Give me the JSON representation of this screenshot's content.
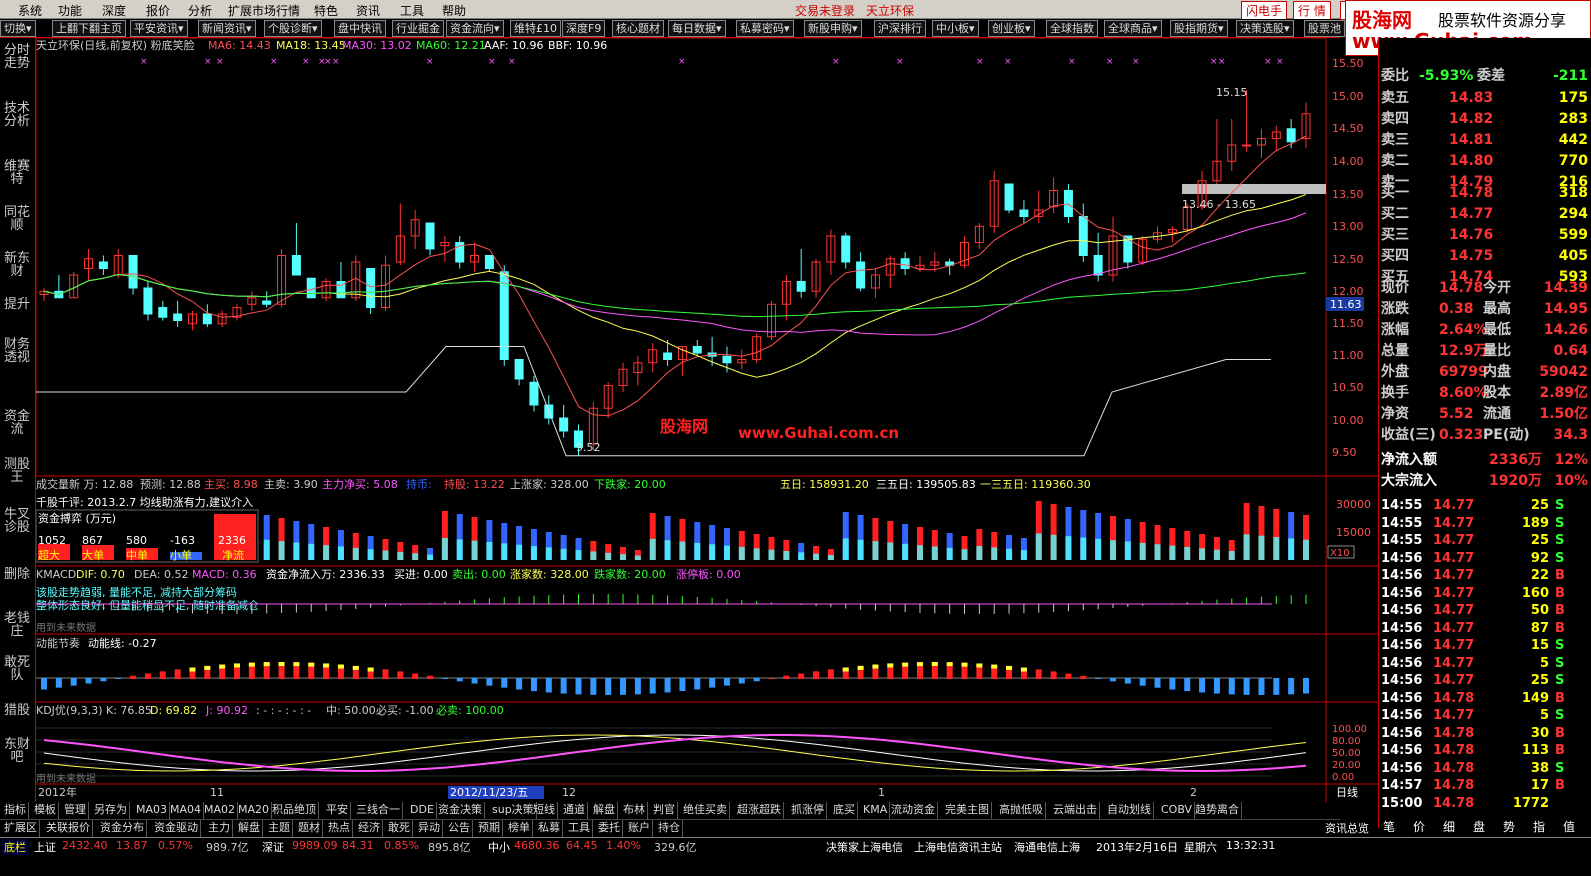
{
  "menu": [
    "系统",
    "功能",
    "深度",
    "报价",
    "分析",
    "扩展市场行情",
    "特色",
    "资讯",
    "工具",
    "帮助"
  ],
  "menu_right": {
    "login": "交易未登录",
    "stock": "天立环保",
    "flash": "闪电手",
    "quote": "行 情",
    "ask": "资 讯"
  },
  "logo": {
    "line1": "股海网",
    "line2": "股票软件资源分享",
    "url": "www.Guhai.com"
  },
  "toolbar": [
    "切换▾",
    "上翻下翻主页",
    "平安资讯▾",
    "新闻资讯▾",
    "个股诊断▾",
    "盘中快讯",
    "行业掘金",
    "资金流向▾",
    "维特£10",
    "深度F9",
    "核心题材",
    "每日数据▾",
    "私募密码▾",
    "新股申购▾",
    "沪深排行",
    "中小板▾",
    "创业板▾",
    "全球指数",
    "全球商品▾",
    "股指期货▾",
    "决策选股▾",
    "股票池"
  ],
  "sidebar": [
    "分时走势",
    "技术分析",
    "维赛特",
    "同花顺",
    "新东财",
    "提升",
    "财务透视",
    "资金流",
    "测股王",
    "牛叉诊股",
    "删除",
    "老钱庄",
    "敢死队",
    "猎股",
    "东财吧"
  ],
  "main_title": {
    "name": "天立环保(日线,前复权) 粉底笑脸",
    "ma6": "MA6: 14.43",
    "ma18": "MA18: 13.45",
    "ma30": "MA30: 13.02",
    "ma60": "MA60: 12.21",
    "aaf": "AAF: 10.96",
    "bbf": "BBF: 10.96"
  },
  "watermark": {
    "cn": "股海网",
    "url": "www.Guhai.com.cn"
  },
  "price_axis": [
    "15.50",
    "15.00",
    "14.50",
    "14.00",
    "13.50",
    "13.00",
    "12.50",
    "12.00",
    "11.50",
    "11.00",
    "10.50",
    "10.00",
    "9.50"
  ],
  "price_tag": "11.63",
  "annotations": {
    "high": "15.15",
    "low": "9.52",
    "band": "13.46 - 13.65"
  },
  "vol_title": {
    "a": "成交量新 万: 12.88",
    "b": "预测: 12.88",
    "c": "主买: 8.98",
    "d": "主卖: 3.90",
    "e": "主力净买: 5.08",
    "f": "持币: ",
    "g": "持股: 13.22",
    "h": "上涨家: 328.00",
    "i": "下跌家: 20.00",
    "j": "五日: 158931.20",
    "k": "三五日: 139505.83",
    "l": "一三五日: 119360.30"
  },
  "vol_note": "千股千评: 2013.2.7  均线助涨有力,建议介入",
  "fund_box": {
    "title": "资金搏弈 (万元)",
    "values": [
      "1052",
      "867",
      "580",
      "-163",
      "2336"
    ],
    "labels": [
      "超大",
      "大单",
      "中单",
      "小单",
      "净流"
    ]
  },
  "vol_axis": [
    "30000",
    "15000"
  ],
  "vol_unit": "X10",
  "macd_title": {
    "a": "KMACD",
    "b": "DIF: 0.70",
    "c": "DEA: 0.52",
    "d": "MACD: 0.36",
    "e": "资金净流入万: 2336.33",
    "f": "买进: 0.00",
    "g": "卖出: 0.00",
    "h": "涨家数: 328.00",
    "i": "跌家数: 20.00",
    "j": "涨停板: 0.00"
  },
  "macd_notes": [
    "该股走势趋弱, 量能不足, 减持大部分筹码",
    "整体形态良好, 但量能稍显不足, 随时准备减仓",
    "用到未来数据"
  ],
  "dn_title": {
    "a": "动能节奏",
    "b": "动能线: -0.27"
  },
  "kdj_title": {
    "a": "KDJ优(9,3,3)",
    "b": "K: 76.85",
    "c": "D: 69.82",
    "d": "J: 90.92",
    "e": ": - : - : - : -",
    "f": "中: 50.00",
    "g": "必买: -1.00",
    "h": "必卖: 100.00"
  },
  "kdj_note": "用到未来数据",
  "kdj_axis": [
    "100.00",
    "80.00",
    "50.00",
    "20.00",
    "0.00"
  ],
  "date_axis": {
    "y": "2012年",
    "m11": "11",
    "cur": "2012/11/23/五",
    "m12": "12",
    "m1": "1",
    "m2": "2",
    "type": "日线"
  },
  "quote": {
    "weibi": {
      "l": "委比",
      "v": "-5.93%",
      "l2": "委差",
      "v2": "-211"
    },
    "sell": [
      {
        "l": "卖五",
        "p": "14.83",
        "v": "175"
      },
      {
        "l": "卖四",
        "p": "14.82",
        "v": "283"
      },
      {
        "l": "卖三",
        "p": "14.81",
        "v": "442"
      },
      {
        "l": "卖二",
        "p": "14.80",
        "v": "770"
      },
      {
        "l": "卖一",
        "p": "14.79",
        "v": "216"
      }
    ],
    "buy": [
      {
        "l": "买一",
        "p": "14.78",
        "v": "318"
      },
      {
        "l": "买二",
        "p": "14.77",
        "v": "294"
      },
      {
        "l": "买三",
        "p": "14.76",
        "v": "599"
      },
      {
        "l": "买四",
        "p": "14.75",
        "v": "405"
      },
      {
        "l": "买五",
        "p": "14.74",
        "v": "593"
      }
    ],
    "stats": [
      {
        "a": "现价",
        "b": "14.78",
        "c": "今开",
        "d": "14.39"
      },
      {
        "a": "涨跌",
        "b": "0.38",
        "c": "最高",
        "d": "14.95"
      },
      {
        "a": "涨幅",
        "b": "2.64%",
        "c": "最低",
        "d": "14.26"
      },
      {
        "a": "总量",
        "b": "12.9万",
        "c": "量比",
        "d": "0.64"
      },
      {
        "a": "外盘",
        "b": "69799",
        "c": "内盘",
        "d": "59042"
      },
      {
        "a": "换手",
        "b": "8.60%",
        "c": "股本",
        "d": "2.89亿"
      },
      {
        "a": "净资",
        "b": "5.52",
        "c": "流通",
        "d": "1.50亿"
      },
      {
        "a": "收益(三)",
        "b": "0.323",
        "c": "PE(动)",
        "d": "34.3"
      }
    ],
    "flow": [
      {
        "a": "净流入额",
        "b": "2336万",
        "c": "12%"
      },
      {
        "a": "大宗流入",
        "b": "1920万",
        "c": "10%"
      }
    ],
    "ticks": [
      {
        "t": "14:55",
        "p": "14.77",
        "v": "25",
        "s": "S"
      },
      {
        "t": "14:55",
        "p": "14.77",
        "v": "189",
        "s": "S"
      },
      {
        "t": "14:55",
        "p": "14.77",
        "v": "25",
        "s": "S"
      },
      {
        "t": "14:56",
        "p": "14.77",
        "v": "92",
        "s": "S"
      },
      {
        "t": "14:56",
        "p": "14.77",
        "v": "22",
        "s": "B"
      },
      {
        "t": "14:56",
        "p": "14.77",
        "v": "160",
        "s": "B"
      },
      {
        "t": "14:56",
        "p": "14.77",
        "v": "50",
        "s": "B"
      },
      {
        "t": "14:56",
        "p": "14.77",
        "v": "87",
        "s": "B"
      },
      {
        "t": "14:56",
        "p": "14.77",
        "v": "15",
        "s": "S"
      },
      {
        "t": "14:56",
        "p": "14.77",
        "v": "5",
        "s": "S"
      },
      {
        "t": "14:56",
        "p": "14.77",
        "v": "25",
        "s": "S"
      },
      {
        "t": "14:56",
        "p": "14.78",
        "v": "149",
        "s": "B"
      },
      {
        "t": "14:56",
        "p": "14.77",
        "v": "5",
        "s": "S"
      },
      {
        "t": "14:56",
        "p": "14.78",
        "v": "30",
        "s": "B"
      },
      {
        "t": "14:56",
        "p": "14.78",
        "v": "113",
        "s": "B"
      },
      {
        "t": "14:56",
        "p": "14.78",
        "v": "38",
        "s": "S"
      },
      {
        "t": "14:57",
        "p": "14.78",
        "v": "17",
        "s": "B"
      },
      {
        "t": "15:00",
        "p": "14.78",
        "v": "1772",
        "s": ""
      }
    ],
    "bottom_tabs": [
      "笔",
      "价",
      "细",
      "盘",
      "势",
      "指",
      "值"
    ]
  },
  "btabs": [
    "指标",
    "模板",
    "管理",
    "另存为",
    "MA03",
    "MA04",
    "MA02",
    "MA20",
    "积品绝顶",
    "平安",
    "三线合一",
    "DDE",
    "资金决策",
    "sup决策",
    "短线",
    "通道",
    "解盘",
    "布林",
    "判官",
    "绝佳买卖",
    "超涨超跌",
    "抓涨停",
    "底买",
    "KMA",
    "流动资金",
    "完美主图",
    "高抛低吸",
    "云端出击",
    "自动划线",
    "COBV",
    "趋势离合"
  ],
  "btabs2": [
    "扩展区",
    "关联报价",
    "资金分布",
    "资金驱动",
    "主力",
    "解盘",
    "主题",
    "题材",
    "热点",
    "经济",
    "敢死",
    "异动",
    "公告",
    "预期",
    "榜单",
    "私募",
    "工具",
    "委托",
    "账户",
    "持仓"
  ],
  "right_tab": "资讯总览",
  "status": {
    "a": "底栏",
    "b": "上证",
    "b1": "2432.40",
    "b2": "13.87",
    "b3": "0.57%",
    "b4": "989.7亿",
    "c": "深证",
    "c1": "9989.09",
    "c2": "84.31",
    "c3": "0.85%",
    "c4": "895.8亿",
    "d": "中小",
    "d1": "4680.36",
    "d2": "64.45",
    "d3": "1.40%",
    "d4": "329.6亿",
    "e": "决策家上海电信",
    "f": "上海电信资讯主站",
    "g": "海通电信上海",
    "h": "2013年2月16日",
    "i": "星期六",
    "j": "13:32:31"
  },
  "colors": {
    "up": "#ff3333",
    "down": "#54ffff",
    "ma6": "#ff5050",
    "ma18": "#ffff55",
    "ma30": "#ff55ff",
    "ma60": "#33ff33"
  }
}
